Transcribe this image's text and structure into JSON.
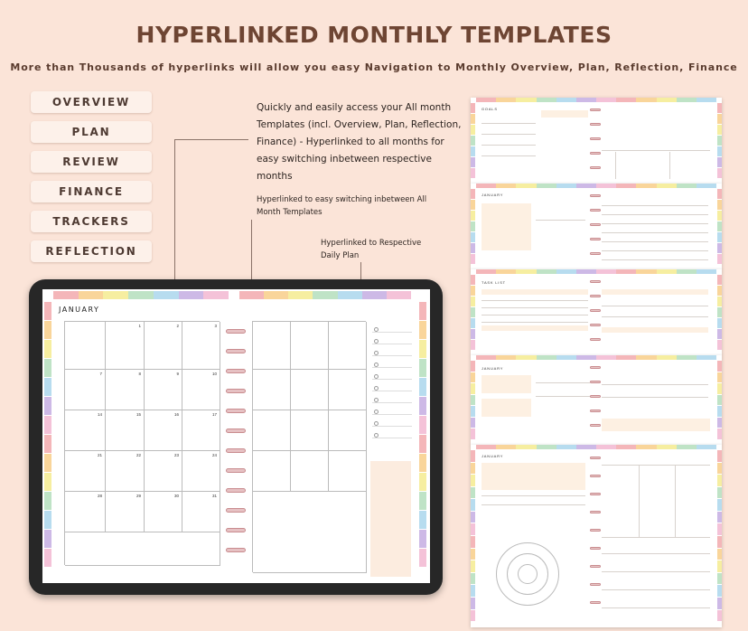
{
  "header": {
    "title": "HYPERLINKED MONTHLY TEMPLATES",
    "subtitle": "More than Thousands of hyperlinks will allow you easy Navigation to Monthly Overview, Plan, Reflection, Finance"
  },
  "nav_buttons": [
    "OVERVIEW",
    "PLAN",
    "REVIEW",
    "FINANCE",
    "TRACKERS",
    "REFLECTION"
  ],
  "callouts": {
    "main": "Quickly and easily access your All month Templates (incl. Overview, Plan, Reflection, Finance) - Hyperlinked to all months for easy switching inbetween respective months",
    "switching": "Hyperlinked to easy switching inbetween All Month Templates",
    "daily": "Hyperlinked to Respective Daily Plan"
  },
  "planner": {
    "month": "JANUARY",
    "dates_row1": [
      "1",
      "2",
      "3"
    ],
    "dates_row2": [
      "7",
      "8",
      "9",
      "10"
    ],
    "dates_row3": [
      "14",
      "15",
      "16",
      "17"
    ],
    "dates_row4": [
      "21",
      "22",
      "23",
      "24"
    ],
    "dates_row5": [
      "28",
      "29",
      "30",
      "31"
    ]
  },
  "pages": {
    "p1_title": "GOALS",
    "p2_title": "JANUARY",
    "p3_title": "TASK LIST",
    "p4_title": "JANUARY",
    "p5_title": "JANUARY"
  },
  "colors": {
    "background": "#fbe4d8",
    "title": "#6e4533",
    "tab_palette": [
      "#f4b6b9",
      "#f9d59a",
      "#f6eea0",
      "#bfe3c6",
      "#b7dcef",
      "#cdb9e6",
      "#f4c2d8"
    ]
  }
}
